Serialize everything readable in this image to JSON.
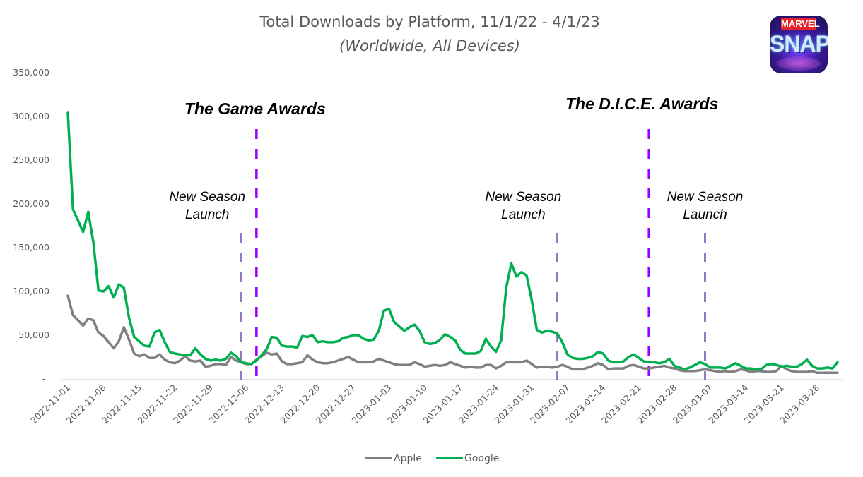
{
  "chart_data": {
    "type": "line",
    "title": "Total Downloads by Platform, 11/1/22 - 4/1/23",
    "subtitle": "(Worldwide, All Devices)",
    "xlabel": "",
    "ylabel": "",
    "ylim": [
      0,
      350000
    ],
    "grid": false,
    "legend_position": "bottom",
    "y_ticks": [
      0,
      50000,
      100000,
      150000,
      200000,
      250000,
      300000,
      350000
    ],
    "y_tick_labels": [
      "-",
      "50,000",
      "100,000",
      "150,000",
      "200,000",
      "250,000",
      "300,000",
      "350,000"
    ],
    "x_start": "2022-11-01",
    "x_end": "2023-04-01",
    "x_tick_labels": [
      "2022-11-01",
      "2022-11-08",
      "2022-11-15",
      "2022-11-22",
      "2022-11-29",
      "2022-12-06",
      "2022-12-13",
      "2022-12-20",
      "2022-12-27",
      "2023-01-03",
      "2023-01-10",
      "2023-01-17",
      "2023-01-24",
      "2023-01-31",
      "2023-02-07",
      "2023-02-14",
      "2023-02-21",
      "2023-02-28",
      "2023-03-07",
      "2023-03-14",
      "2023-03-21",
      "2023-03-28"
    ],
    "series": [
      {
        "name": "Apple",
        "color": "#808080",
        "values": [
          95000,
          73000,
          67000,
          61000,
          69000,
          67000,
          53000,
          49000,
          42000,
          35000,
          43000,
          59000,
          45000,
          29000,
          26000,
          28000,
          24000,
          24000,
          28000,
          22000,
          19000,
          18000,
          21000,
          26000,
          21000,
          20000,
          21000,
          14000,
          15000,
          17000,
          17000,
          16000,
          25000,
          21000,
          19000,
          17000,
          17000,
          22000,
          26000,
          30000,
          28000,
          29000,
          20000,
          17000,
          17000,
          18000,
          19000,
          27000,
          22000,
          19000,
          18000,
          18000,
          19000,
          21000,
          23000,
          25000,
          22000,
          19000,
          19000,
          19000,
          20000,
          23000,
          21000,
          19000,
          17000,
          16000,
          16000,
          16000,
          19000,
          17000,
          14000,
          15000,
          16000,
          15000,
          16000,
          19000,
          17000,
          15000,
          13000,
          14000,
          13000,
          13000,
          16000,
          16000,
          12000,
          15000,
          19000,
          19000,
          19000,
          19000,
          21000,
          17000,
          13000,
          14000,
          14000,
          13000,
          14000,
          16000,
          14000,
          11000,
          11000,
          11000,
          13000,
          15000,
          18000,
          16000,
          11000,
          12000,
          12000,
          12000,
          15000,
          16000,
          14000,
          12000,
          12000,
          13000,
          14000,
          15000,
          13000,
          12000,
          10000,
          9000,
          9000,
          9000,
          10000,
          11000,
          10000,
          9000,
          8000,
          9000,
          8000,
          9000,
          11000,
          10000,
          8000,
          9000,
          9000,
          8000,
          8000,
          9000,
          15000,
          11000,
          9000,
          8000,
          8000,
          8000,
          9000,
          7000,
          7000,
          7000,
          7000,
          7000
        ]
      },
      {
        "name": "Google",
        "color": "#00b050",
        "values": [
          304000,
          194000,
          181000,
          168000,
          191000,
          156000,
          101000,
          100000,
          106000,
          93000,
          108000,
          104000,
          70000,
          48000,
          43000,
          38000,
          37000,
          53000,
          56000,
          42000,
          31000,
          29000,
          28000,
          27000,
          27000,
          35000,
          28000,
          23000,
          21000,
          22000,
          21000,
          23000,
          30000,
          26000,
          19000,
          18000,
          17000,
          21000,
          27000,
          34000,
          48000,
          47000,
          38000,
          37000,
          37000,
          36000,
          49000,
          48000,
          50000,
          42000,
          43000,
          42000,
          42000,
          43000,
          47000,
          48000,
          50000,
          50000,
          46000,
          44000,
          45000,
          55000,
          78000,
          80000,
          65000,
          60000,
          55000,
          59000,
          62000,
          55000,
          42000,
          40000,
          41000,
          45000,
          51000,
          48000,
          44000,
          33000,
          29000,
          29000,
          29000,
          32000,
          46000,
          37000,
          31000,
          44000,
          104000,
          132000,
          117000,
          122000,
          118000,
          90000,
          56000,
          53000,
          55000,
          54000,
          52000,
          42000,
          28000,
          24000,
          23000,
          23000,
          24000,
          26000,
          31000,
          29000,
          21000,
          19000,
          19000,
          20000,
          25000,
          28000,
          24000,
          20000,
          19000,
          19000,
          18000,
          19000,
          23000,
          15000,
          13000,
          11000,
          13000,
          16000,
          19000,
          17000,
          13000,
          13000,
          13000,
          12000,
          15000,
          18000,
          15000,
          12000,
          12000,
          11000,
          11000,
          16000,
          17000,
          16000,
          14000,
          15000,
          14000,
          14000,
          17000,
          22000,
          15000,
          12000,
          12000,
          13000,
          12000,
          19000
        ]
      }
    ],
    "annotations": [
      {
        "label": "The Game Awards",
        "date": "2022-12-08",
        "style": "major",
        "color": "#9900ff"
      },
      {
        "label": "The D.I.C.E. Awards",
        "date": "2023-02-23",
        "style": "major",
        "color": "#9900ff"
      },
      {
        "label": "New Season Launch",
        "date": "2022-12-05",
        "style": "minor",
        "color": "#8e7cc3"
      },
      {
        "label": "New Season Launch",
        "date": "2023-02-05",
        "style": "minor",
        "color": "#8e7cc3"
      },
      {
        "label": "New Season Launch",
        "date": "2023-03-06",
        "style": "minor",
        "color": "#8e7cc3"
      }
    ]
  },
  "logo": {
    "name": "Marvel Snap",
    "top_text": "MARVEL",
    "main_text": "SNAP"
  }
}
